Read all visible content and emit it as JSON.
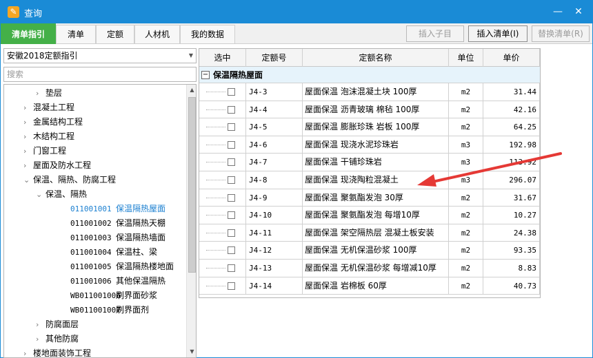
{
  "window": {
    "title": "查询",
    "minimize": "—",
    "close": "✕"
  },
  "tabs": [
    "清单指引",
    "清单",
    "定额",
    "人材机",
    "我的数据"
  ],
  "toolbar": {
    "insert_child": "插入子目",
    "insert_list": "插入清单(I)",
    "replace_list": "替换清单(R)"
  },
  "left": {
    "select_value": "安徽2018定额指引",
    "search_placeholder": "搜索",
    "tree": [
      {
        "indent": 1,
        "arrow": "›",
        "code": "",
        "label": "垫层"
      },
      {
        "indent": 0,
        "arrow": "›",
        "code": "",
        "label": "混凝土工程"
      },
      {
        "indent": 0,
        "arrow": "›",
        "code": "",
        "label": "金属结构工程"
      },
      {
        "indent": 0,
        "arrow": "›",
        "code": "",
        "label": "木结构工程"
      },
      {
        "indent": 0,
        "arrow": "›",
        "code": "",
        "label": "门窗工程"
      },
      {
        "indent": 0,
        "arrow": "›",
        "code": "",
        "label": "屋面及防水工程"
      },
      {
        "indent": 0,
        "arrow": "⌄",
        "code": "",
        "label": "保温、隔热、防腐工程"
      },
      {
        "indent": 1,
        "arrow": "⌄",
        "code": "",
        "label": "保温、隔热"
      },
      {
        "indent": 2,
        "arrow": "",
        "code": "011001001",
        "label": "保温隔热屋面",
        "selected": true
      },
      {
        "indent": 2,
        "arrow": "",
        "code": "011001002",
        "label": "保温隔热天棚"
      },
      {
        "indent": 2,
        "arrow": "",
        "code": "011001003",
        "label": "保温隔热墙面"
      },
      {
        "indent": 2,
        "arrow": "",
        "code": "011001004",
        "label": "保温柱、梁"
      },
      {
        "indent": 2,
        "arrow": "",
        "code": "011001005",
        "label": "保温隔热楼地面"
      },
      {
        "indent": 2,
        "arrow": "",
        "code": "011001006",
        "label": "其他保温隔热"
      },
      {
        "indent": 2,
        "arrow": "",
        "code": "WB011001006",
        "label": "刷界面砂浆"
      },
      {
        "indent": 2,
        "arrow": "",
        "code": "WB011001007",
        "label": "刷界面剂"
      },
      {
        "indent": 1,
        "arrow": "›",
        "code": "",
        "label": "防腐面层"
      },
      {
        "indent": 1,
        "arrow": "›",
        "code": "",
        "label": "其他防腐"
      },
      {
        "indent": 0,
        "arrow": "›",
        "code": "",
        "label": "楼地面装饰工程"
      }
    ]
  },
  "grid": {
    "headers": [
      "选中",
      "定额号",
      "定额名称",
      "单位",
      "单价"
    ],
    "group_label": "保温隔热屋面",
    "group_toggle": "−",
    "rows": [
      {
        "code": "J4-3",
        "name": "屋面保温 泡沫混凝土块 100厚",
        "unit": "m2",
        "price": "31.44"
      },
      {
        "code": "J4-4",
        "name": "屋面保温 沥青玻璃 棉毡 100厚",
        "unit": "m2",
        "price": "42.16"
      },
      {
        "code": "J4-5",
        "name": "屋面保温 膨胀珍珠 岩板 100厚",
        "unit": "m2",
        "price": "64.25"
      },
      {
        "code": "J4-6",
        "name": "屋面保温 现浇水泥珍珠岩",
        "unit": "m3",
        "price": "192.98"
      },
      {
        "code": "J4-7",
        "name": "屋面保温 干铺珍珠岩",
        "unit": "m3",
        "price": "113.92"
      },
      {
        "code": "J4-8",
        "name": "屋面保温 现浇陶粒混凝土",
        "unit": "m3",
        "price": "296.07"
      },
      {
        "code": "J4-9",
        "name": "屋面保温 聚氨酯发泡 30厚",
        "unit": "m2",
        "price": "31.67"
      },
      {
        "code": "J4-10",
        "name": "屋面保温 聚氨酯发泡 每增10厚",
        "unit": "m2",
        "price": "10.27"
      },
      {
        "code": "J4-11",
        "name": "屋面保温 架空隔热层 混凝土板安装",
        "unit": "m2",
        "price": "24.38"
      },
      {
        "code": "J4-12",
        "name": "屋面保温 无机保温砂浆 100厚",
        "unit": "m2",
        "price": "93.35"
      },
      {
        "code": "J4-13",
        "name": "屋面保温 无机保温砂浆 每增减10厚",
        "unit": "m2",
        "price": "8.83"
      },
      {
        "code": "J4-14",
        "name": "屋面保温 岩棉板 60厚",
        "unit": "m2",
        "price": "40.73"
      }
    ]
  },
  "annotation": {
    "arrow_color": "#e53935"
  }
}
